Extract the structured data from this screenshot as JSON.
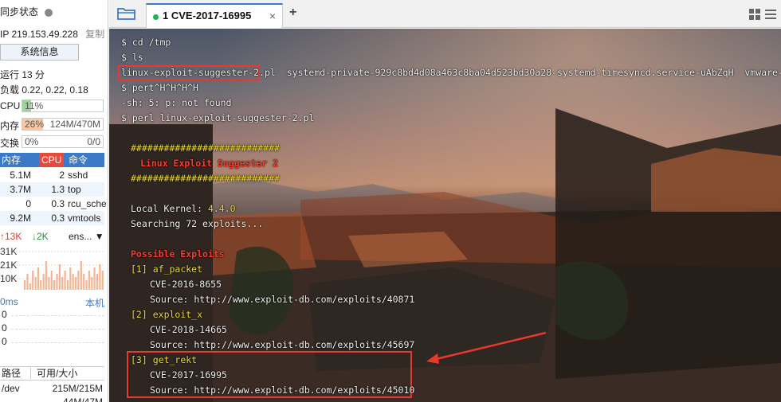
{
  "sidebar": {
    "sync_status": "同步状态",
    "ip": "IP 219.153.49.228",
    "copy": "复制",
    "sysinfo_button": "系统信息",
    "uptime": "运行 13 分",
    "load": "负载 0.22, 0.22, 0.18",
    "cpu": {
      "label": "CPU",
      "value": "11%",
      "fraction": 0.11
    },
    "mem": {
      "label": "内存",
      "percent": "26%",
      "detail": "124M/470M",
      "fraction": 0.26
    },
    "swap": {
      "label": "交换",
      "percent": "0%",
      "detail": "0/0",
      "fraction": 0
    },
    "proc_headers": [
      "内存",
      "CPU",
      "命令"
    ],
    "procs": [
      {
        "mem": "5.1M",
        "cpu": "2",
        "cmd": "sshd"
      },
      {
        "mem": "3.7M",
        "cpu": "1.3",
        "cmd": "top"
      },
      {
        "mem": "0",
        "cpu": "0.3",
        "cmd": "rcu_sche"
      },
      {
        "mem": "9.2M",
        "cpu": "0.3",
        "cmd": "vmtools"
      }
    ],
    "net": {
      "up": "13K",
      "down": "2K",
      "iface": "ens..."
    },
    "net_ticks": [
      "31K",
      "21K",
      "10K"
    ],
    "net_series": [
      0.3,
      0.5,
      0.2,
      0.6,
      0.4,
      0.7,
      0.3,
      0.5,
      0.9,
      0.4,
      0.6,
      0.3,
      0.5,
      0.8,
      0.4,
      0.6,
      0.3,
      0.7,
      0.5,
      0.4,
      0.6,
      0.9,
      0.5,
      0.3,
      0.6,
      0.4,
      0.7,
      0.5,
      0.8,
      0.6
    ],
    "latency": {
      "label": "0ms",
      "local": "本机",
      "values": [
        "0",
        "0",
        "0"
      ]
    },
    "disk_headers": [
      "路径",
      "可用/大小"
    ],
    "disks": [
      {
        "path": "/dev",
        "size": "215M/215M"
      },
      {
        "path": "",
        "size": "44M/47M"
      }
    ]
  },
  "tabbar": {
    "tab_label": "1  CVE-2017-16995",
    "close": "×",
    "add": "+"
  },
  "terminal": {
    "lines": [
      "$ cd /tmp",
      "$ ls",
      "linux-exploit-suggester-2.pl",
      "  systemd-private-929c8bd4d08a463c8ba04d523bd30a28-systemd-timesyncd.service-uAbZqH  vmware-root",
      "$ pert^H^H^H^H",
      "-sh: 5: p: not found",
      "$ perl linux-exploit-suggester-2.pl",
      "###########################",
      "Linux Exploit Suggester 2",
      "###########################",
      "Local Kernel: ",
      "4.4.0",
      "Searching 72 exploits...",
      "Possible Exploits",
      "[1]",
      "af_packet",
      "CVE-2016-8655",
      "Source: http://www.exploit-db.com/exploits/40871",
      "[2]",
      "exploit_x",
      "CVE-2018-14665",
      "Source: http://www.exploit-db.com/exploits/45697",
      "[3]",
      "get_rekt",
      "CVE-2017-16995",
      "Source: http://www.exploit-db.com/exploits/45010"
    ]
  },
  "colors": {
    "accent": "#3c7ac8",
    "highlight": "#e8392e",
    "yellow": "#f0dd3a",
    "red": "#ff3a2e"
  },
  "icons": [
    "folder-icon",
    "grid-icon",
    "menu-icon",
    "arrow-icon"
  ]
}
